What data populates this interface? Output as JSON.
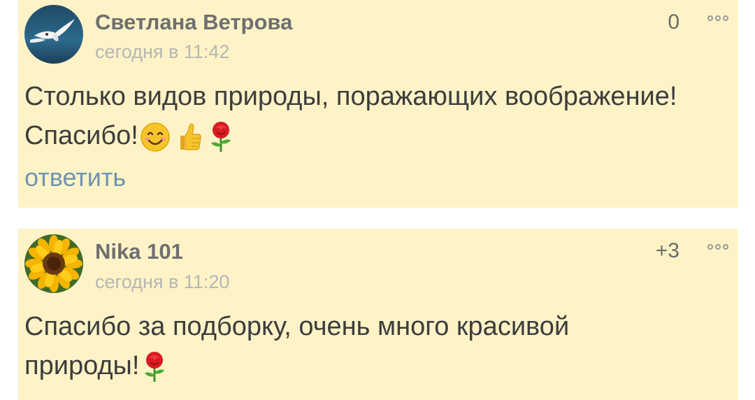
{
  "comments": [
    {
      "author": "Светлана Ветрова",
      "date": "сегодня в 11:42",
      "rating": "0",
      "text_line1": "Столько видов природы, поражающих воображение!",
      "text_line2": "Спасибо!",
      "emojis": [
        "smiling-face-icon",
        "thumbs-up-icon",
        "rose-icon"
      ],
      "reply_label": "ответить",
      "avatar": "seagull-avatar"
    },
    {
      "author": "Nika 101",
      "date": "сегодня в 11:20",
      "rating": "+3",
      "text_line1": "Спасибо за подборку, очень много красивой",
      "text_line2": "природы!",
      "emojis": [
        "rose-icon"
      ],
      "avatar": "sunflower-avatar"
    }
  ],
  "colors": {
    "card_background": "#fdf3c7",
    "author": "#6f6f6f",
    "date": "#b6b6b6",
    "reply_link": "#6e94b2"
  }
}
